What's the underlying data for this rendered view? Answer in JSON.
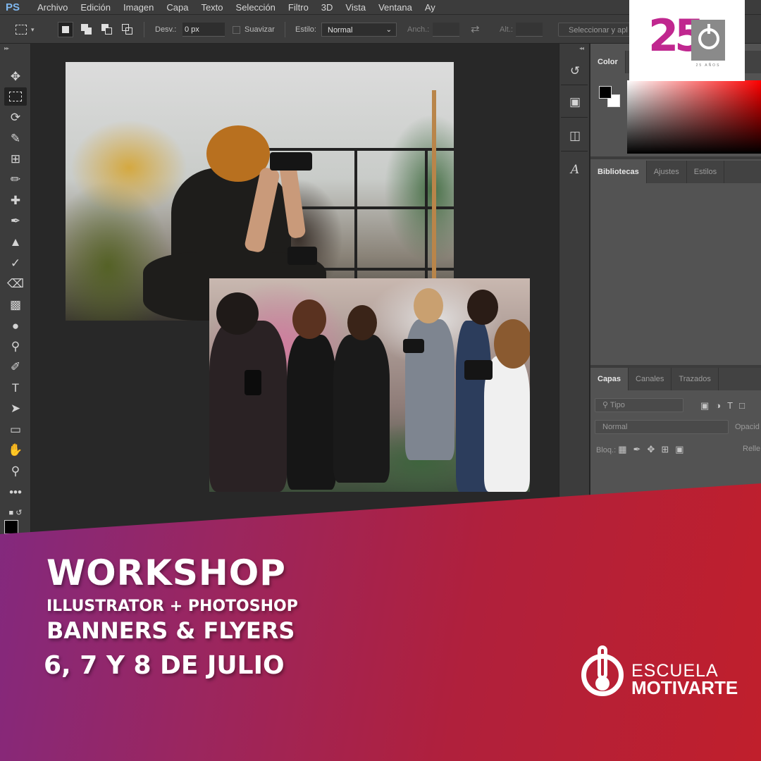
{
  "menubar": {
    "logo": "PS",
    "items": [
      "Archivo",
      "Edición",
      "Imagen",
      "Capa",
      "Texto",
      "Selección",
      "Filtro",
      "3D",
      "Vista",
      "Ventana",
      "Ay"
    ]
  },
  "options": {
    "feather_label": "Desv.:",
    "feather_value": "0 px",
    "antialias_label": "Suavizar",
    "style_label": "Estilo:",
    "style_value": "Normal",
    "width_label": "Anch.:",
    "height_label": "Alt.:",
    "select_mask_label": "Seleccionar y apl"
  },
  "panels": {
    "color_tab": "Color",
    "library_tabs": [
      "Bibliotecas",
      "Ajustes",
      "Estilos"
    ],
    "layers_tabs": [
      "Capas",
      "Canales",
      "Trazados"
    ],
    "filter_placeholder": "Tipo",
    "blend_mode": "Normal",
    "opacity_label": "Opacid",
    "lock_label": "Bloq.:",
    "fill_label": "Relle"
  },
  "badge": {
    "number": "25",
    "subtext": "25 AÑOS"
  },
  "banner": {
    "title": "WORKSHOP",
    "subtitle": "ILLUSTRATOR + PHOTOSHOP",
    "topic": "BANNERS & FLYERS",
    "dates": "6, 7 Y 8 DE JULIO",
    "gradient_start": "#7a2a8a",
    "gradient_end": "#c01f2c"
  },
  "school": {
    "line1": "ESCUELA",
    "line2": "MOTIVARTE"
  }
}
